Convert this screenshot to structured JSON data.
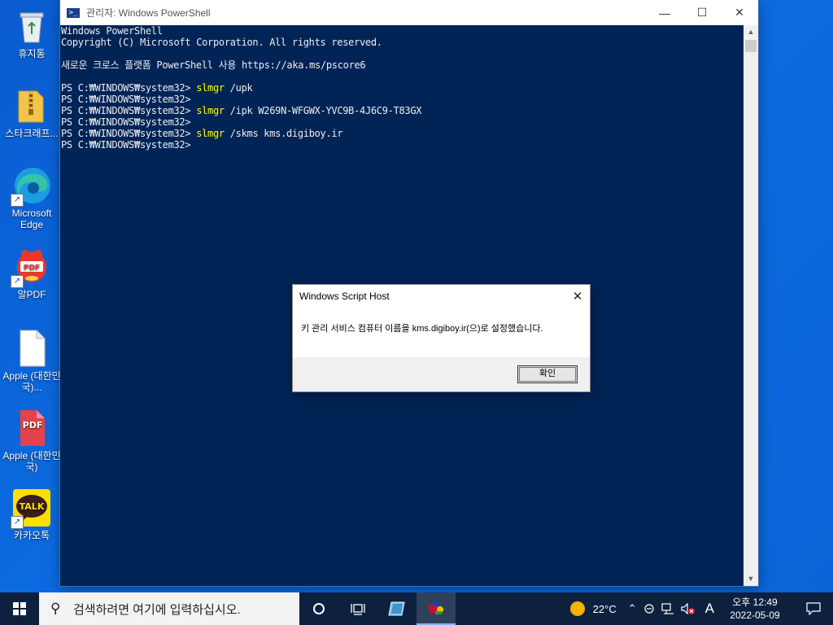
{
  "desktop": {
    "icons": [
      {
        "label": "휴지통",
        "icon": "recycle-bin-icon"
      },
      {
        "label": "스타크래프...",
        "icon": "zip-folder-icon"
      },
      {
        "label": "Microsoft Edge",
        "icon": "edge-icon"
      },
      {
        "label": "알PDF",
        "icon": "alpdf-icon"
      },
      {
        "label": "Apple (대한민국)...",
        "icon": "blank-document-icon"
      },
      {
        "label": "Apple (대한민국)",
        "icon": "pdf-document-icon"
      },
      {
        "label": "카카오톡",
        "icon": "kakaotalk-icon"
      }
    ]
  },
  "powershell": {
    "title": "관리자: Windows PowerShell",
    "lines": [
      {
        "prompt": "",
        "cmd": "",
        "args": "Windows PowerShell"
      },
      {
        "prompt": "",
        "cmd": "",
        "args": "Copyright (C) Microsoft Corporation. All rights reserved."
      },
      {
        "prompt": "",
        "cmd": "",
        "args": ""
      },
      {
        "prompt": "",
        "cmd": "",
        "args": "새로운 크로스 플랫폼 PowerShell 사용 https://aka.ms/pscore6"
      },
      {
        "prompt": "",
        "cmd": "",
        "args": ""
      },
      {
        "prompt": "PS C:₩WINDOWS₩system32> ",
        "cmd": "slmgr",
        "args": " /upk"
      },
      {
        "prompt": "PS C:₩WINDOWS₩system32>",
        "cmd": "",
        "args": ""
      },
      {
        "prompt": "PS C:₩WINDOWS₩system32> ",
        "cmd": "slmgr",
        "args": " /ipk W269N-WFGWX-YVC9B-4J6C9-T83GX"
      },
      {
        "prompt": "PS C:₩WINDOWS₩system32>",
        "cmd": "",
        "args": ""
      },
      {
        "prompt": "PS C:₩WINDOWS₩system32> ",
        "cmd": "slmgr",
        "args": " /skms kms.digiboy.ir"
      },
      {
        "prompt": "PS C:₩WINDOWS₩system32>",
        "cmd": "",
        "args": ""
      }
    ]
  },
  "dialog": {
    "title": "Windows Script Host",
    "message": "키 관리 서비스 컴퓨터 이름을 kms.digiboy.ir(으)로 설정했습니다.",
    "ok_label": "확인"
  },
  "taskbar": {
    "search_placeholder": "검색하려면 여기에 입력하십시오.",
    "weather": "22°C",
    "ime": "A",
    "time": "오후 12:49",
    "date": "2022-05-09"
  },
  "colors": {
    "console_bg": "#012456",
    "console_text": "#eeedf0",
    "console_cmd": "#ffff00",
    "desktop": "#0a64d6"
  }
}
